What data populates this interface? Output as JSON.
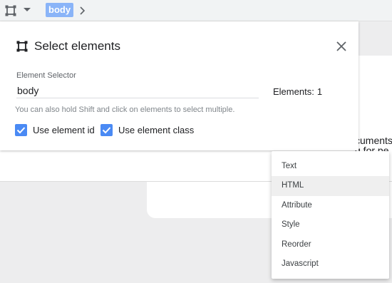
{
  "toolbar": {
    "select_icon": "select-element-icon",
    "dropdown_icon": "caret-down-icon",
    "breadcrumb_chip": "body",
    "chevron_icon": "chevron-right-icon"
  },
  "dialog": {
    "icon": "select-element-icon",
    "title": "Select elements",
    "close_icon": "close-icon",
    "selector_label": "Element Selector",
    "selector_value": "body",
    "count_label": "Elements:",
    "count_value": "1",
    "hint": "You can also hold Shift and click on elements to select multiple.",
    "options": [
      {
        "label": "Use element id",
        "checked": true
      },
      {
        "label": "Use element class",
        "checked": true
      }
    ]
  },
  "background_text": {
    "line1": "cuments",
    "line2": "g for pe"
  },
  "menu": {
    "items": [
      {
        "label": "Text"
      },
      {
        "label": "HTML"
      },
      {
        "label": "Attribute"
      },
      {
        "label": "Style"
      },
      {
        "label": "Reorder"
      },
      {
        "label": "Javascript"
      }
    ],
    "highlighted_index": 1
  },
  "colors": {
    "accent": "#4a8af4",
    "chip": "#8ab4f8",
    "text": "#202124",
    "muted": "#80868b"
  }
}
